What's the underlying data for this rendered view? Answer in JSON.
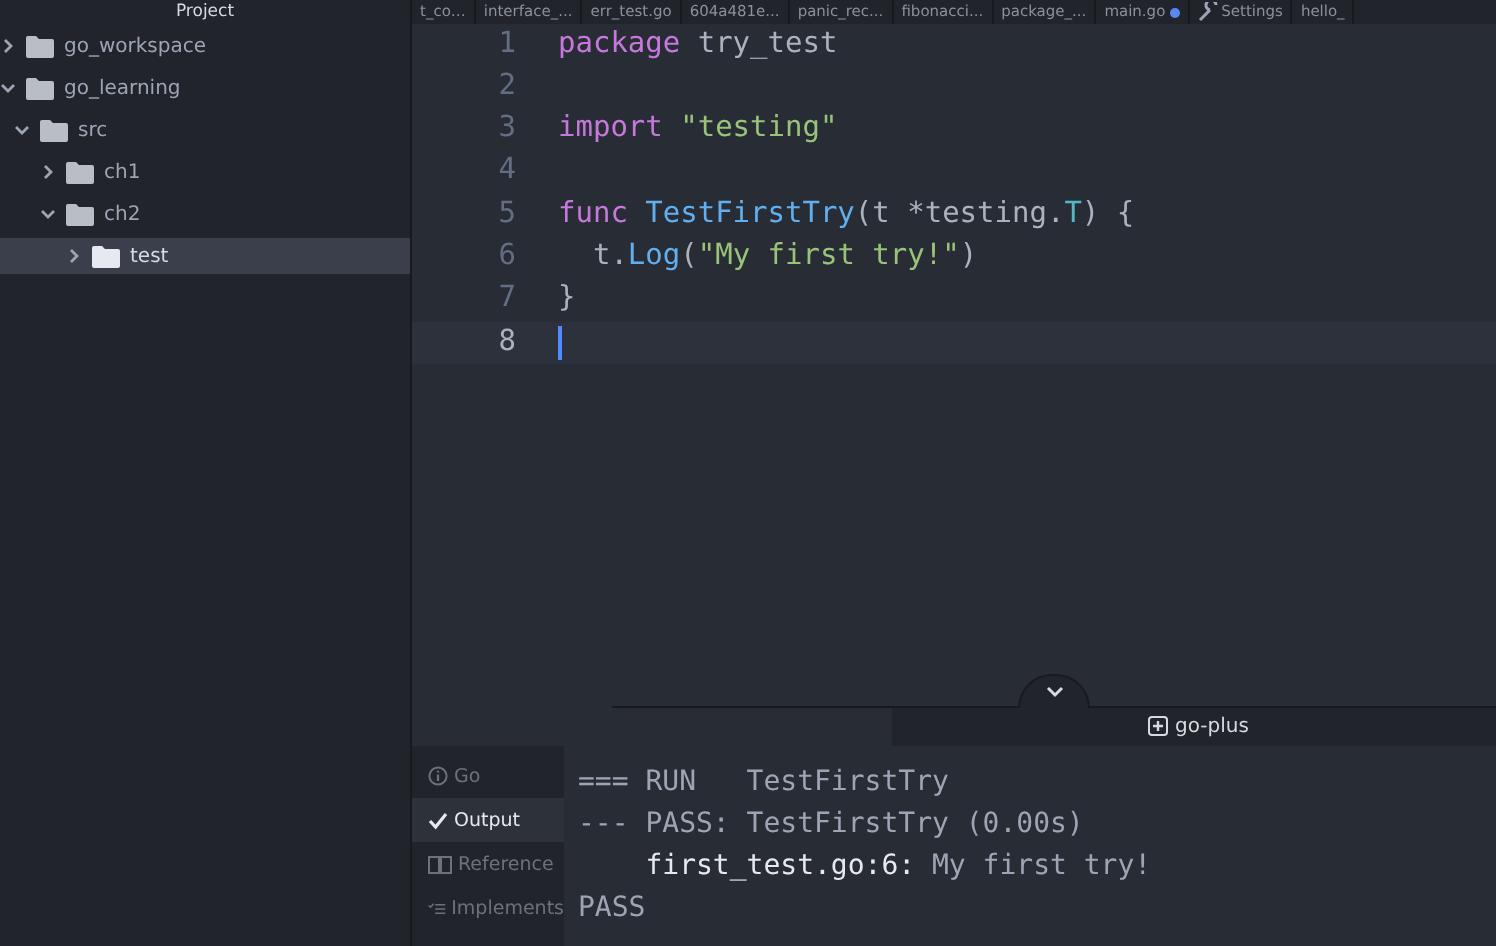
{
  "sidebar": {
    "title": "Project",
    "tree": [
      {
        "label": "go_workspace",
        "expanded": false,
        "selected": false
      },
      {
        "label": "go_learning",
        "expanded": true,
        "selected": false,
        "children": [
          {
            "label": "src",
            "expanded": true,
            "selected": false,
            "children": [
              {
                "label": "ch1",
                "expanded": false,
                "selected": false
              },
              {
                "label": "ch2",
                "expanded": true,
                "selected": false,
                "children": [
                  {
                    "label": "test",
                    "expanded": false,
                    "selected": true
                  }
                ]
              }
            ]
          }
        ]
      }
    ]
  },
  "tabs": [
    {
      "label": "t_co…",
      "modified": false,
      "kind": "file"
    },
    {
      "label": "interface_...",
      "modified": false,
      "kind": "file"
    },
    {
      "label": "err_test.go",
      "modified": false,
      "kind": "file"
    },
    {
      "label": "604a481e...",
      "modified": false,
      "kind": "file"
    },
    {
      "label": "panic_rec...",
      "modified": false,
      "kind": "file"
    },
    {
      "label": "fibonacci...",
      "modified": false,
      "kind": "file"
    },
    {
      "label": "package_...",
      "modified": false,
      "kind": "file"
    },
    {
      "label": "main.go",
      "modified": true,
      "kind": "file"
    },
    {
      "label": "Settings",
      "modified": false,
      "kind": "settings"
    },
    {
      "label": "hello_",
      "modified": false,
      "kind": "file"
    }
  ],
  "editor": {
    "lines": [
      {
        "number": "1",
        "current": false,
        "tokens": [
          {
            "text": "package",
            "kind": "keyword"
          },
          {
            "text": " try_test",
            "kind": "plain"
          }
        ]
      },
      {
        "number": "2",
        "current": false
      },
      {
        "number": "3",
        "current": false,
        "tokens": [
          {
            "text": "import",
            "kind": "keyword"
          },
          {
            "text": " \"testing\"",
            "kind": "string"
          }
        ]
      },
      {
        "number": "4",
        "current": false
      },
      {
        "number": "5",
        "current": false,
        "tokens": [
          {
            "text": "func",
            "kind": "keyword"
          },
          {
            "text": " TestFirstTry",
            "kind": "function"
          },
          {
            "text": "(t *testing.",
            "kind": "plain"
          },
          {
            "text": "T",
            "kind": "type"
          },
          {
            "text": ") {",
            "kind": "plain"
          }
        ]
      },
      {
        "number": "6",
        "current": false,
        "tokens": [
          {
            "text": "  t.",
            "kind": "plain"
          },
          {
            "text": "Log",
            "kind": "function"
          },
          {
            "text": "(",
            "kind": "plain"
          },
          {
            "text": "\"My first try!\"",
            "kind": "string"
          },
          {
            "text": ")",
            "kind": "plain"
          }
        ]
      },
      {
        "number": "7",
        "current": false,
        "tokens": [
          {
            "text": "}",
            "kind": "plain"
          }
        ]
      },
      {
        "number": "8",
        "current": true
      }
    ]
  },
  "panel": {
    "title": "go-plus",
    "tabs": [
      {
        "label": "Go",
        "selected": false
      },
      {
        "label": "Output",
        "selected": true
      },
      {
        "label": "Reference",
        "selected": false
      },
      {
        "label": "Implements",
        "selected": false
      }
    ],
    "output": [
      [
        {
          "text": "=== RUN   TestFirstTry",
          "kind": "dim"
        }
      ],
      [
        {
          "text": "--- PASS: TestFirstTry (0.00s)",
          "kind": "dim"
        }
      ],
      [
        {
          "text": "    first_test.go:6:",
          "kind": "bright"
        },
        {
          "text": " My first try!",
          "kind": "dim"
        }
      ],
      [
        {
          "text": "PASS",
          "kind": "dim"
        }
      ]
    ]
  }
}
